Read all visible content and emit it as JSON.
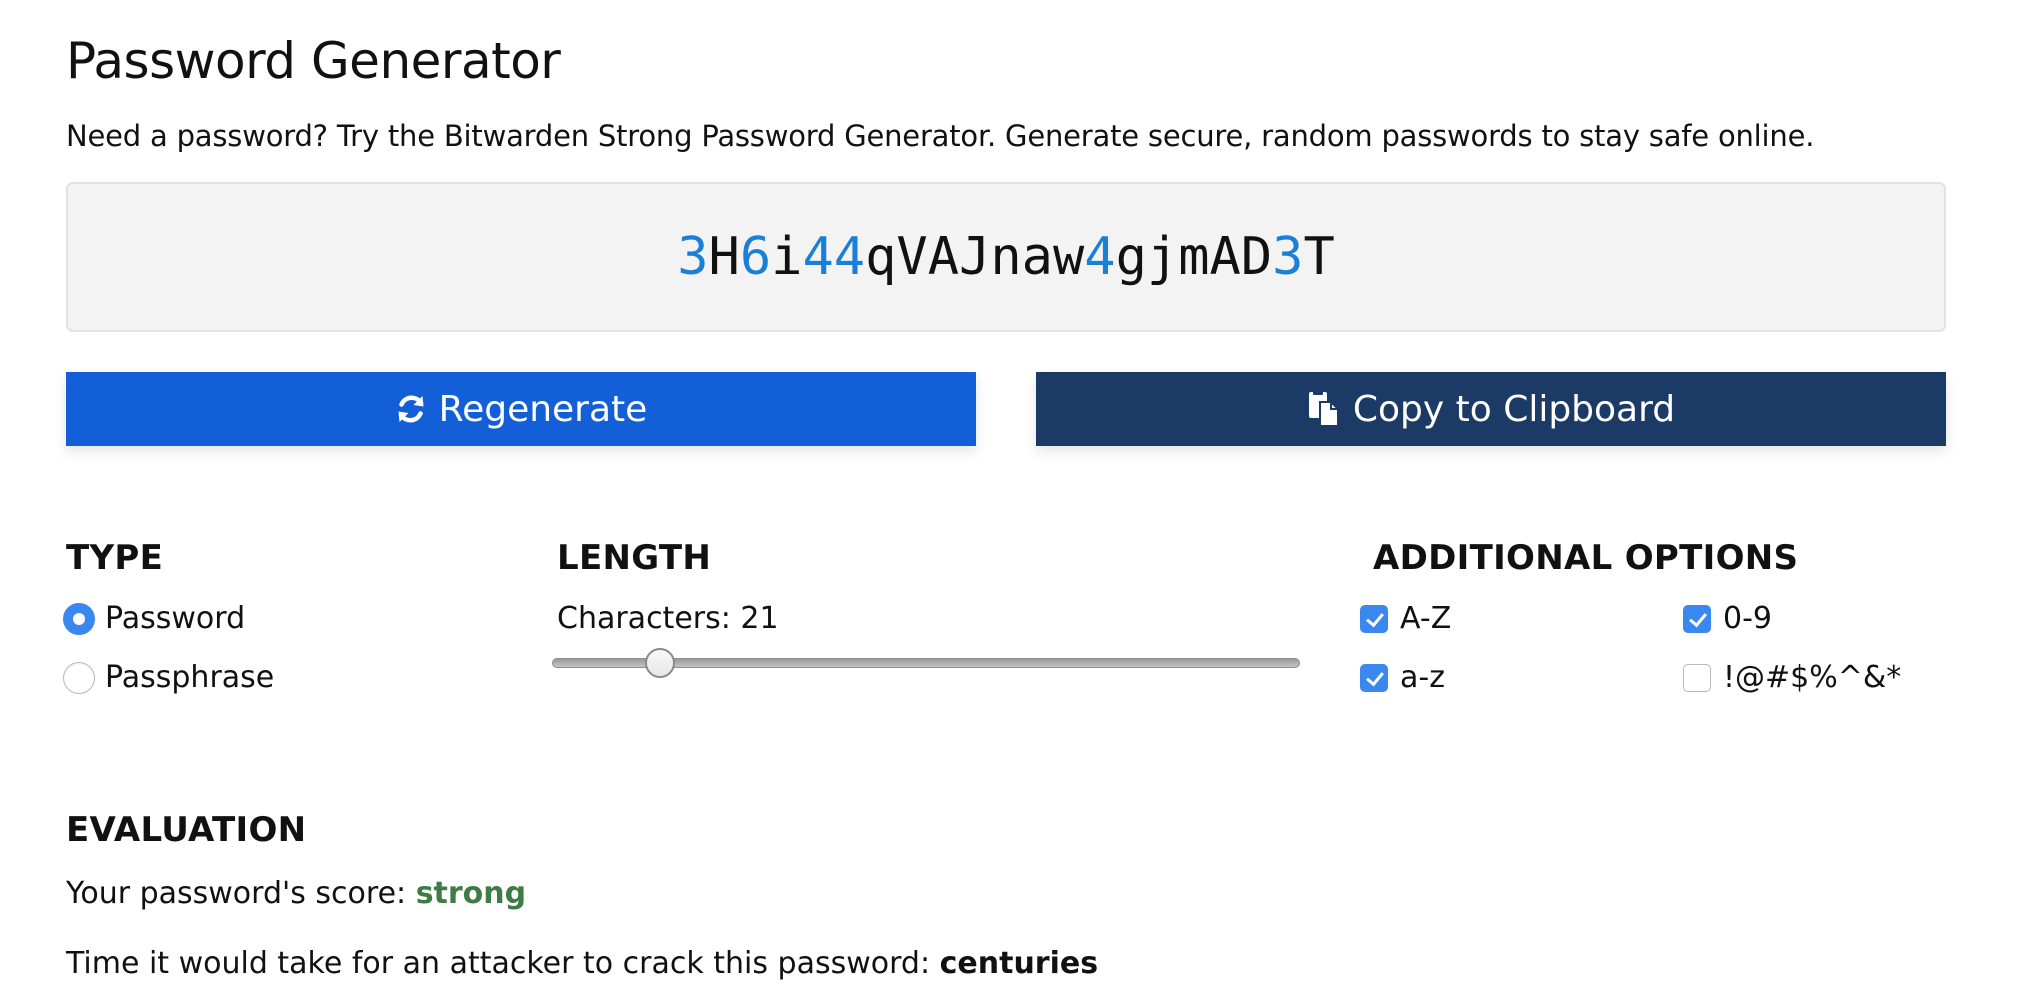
{
  "header": {
    "title": "Password Generator",
    "subtitle": "Need a password? Try the Bitwarden Strong Password Generator. Generate secure, random passwords to stay safe online."
  },
  "password": {
    "value": "3H6i44qVAJnaw4gjmAD3T",
    "digit_color": "#1a7fd6"
  },
  "buttons": {
    "regenerate": {
      "label": "Regenerate",
      "icon": "refresh-icon",
      "color": "#125fd8"
    },
    "copy": {
      "label": "Copy to Clipboard",
      "icon": "copy-icon",
      "color": "#1b3a66"
    }
  },
  "type": {
    "heading": "TYPE",
    "options": [
      {
        "label": "Password",
        "selected": true
      },
      {
        "label": "Passphrase",
        "selected": false
      }
    ]
  },
  "length": {
    "heading": "LENGTH",
    "label": "Characters: 21",
    "value": 21,
    "min": 5,
    "max": 128
  },
  "additional_options": {
    "heading": "ADDITIONAL OPTIONS",
    "options": [
      {
        "label": "A-Z",
        "checked": true
      },
      {
        "label": "a-z",
        "checked": true
      },
      {
        "label": "0-9",
        "checked": true
      },
      {
        "label": "!@#$%^&*",
        "checked": false
      }
    ],
    "accent_color": "#3b87f0"
  },
  "evaluation": {
    "heading": "EVALUATION",
    "score_prefix": "Your password's score: ",
    "score_value": "strong",
    "score_color": "#3e7b45",
    "crack_prefix": "Time it would take for an attacker to crack this password: ",
    "crack_value": "centuries"
  }
}
